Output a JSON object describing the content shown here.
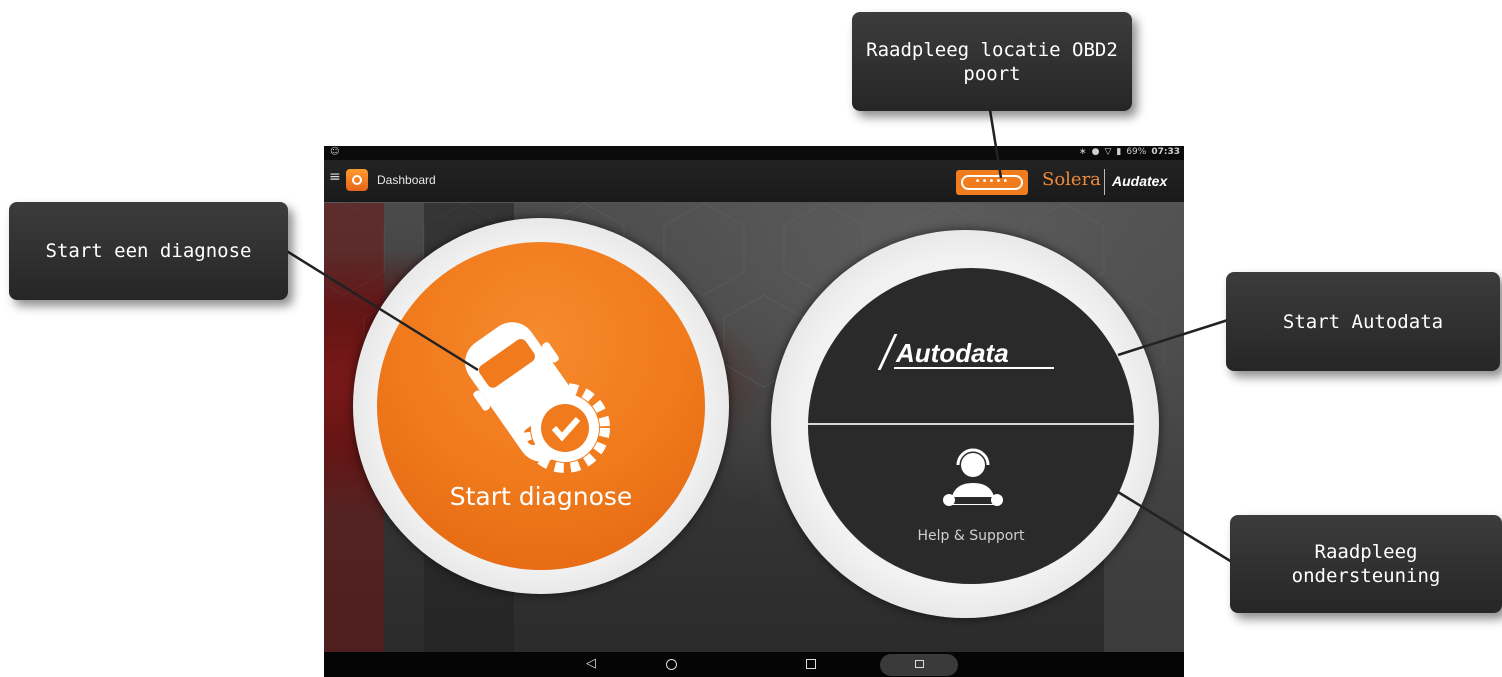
{
  "statusbar": {
    "left_icon": "android-debug-icon",
    "battery": "69%",
    "time": "07:33"
  },
  "appbar": {
    "title": "Dashboard",
    "obd_button_dots": "•••••",
    "brand_primary": "Solera",
    "brand_secondary": "Audatex"
  },
  "tiles": {
    "diagnose_label": "Start diagnose",
    "autodata_label": "Autodata",
    "help_label": "Help & Support"
  },
  "callouts": {
    "diagnose": "Start een diagnose",
    "obd": "Raadpleeg locatie OBD2 poort",
    "autodata": "Start Autodata",
    "support": "Raadpleeg ondersteuning"
  },
  "navbar": {
    "back_icon": "back-triangle-icon",
    "home_icon": "home-circle-icon",
    "recent_icon": "recent-square-icon"
  },
  "colors": {
    "accent": "#f07c1e",
    "dark_tile": "#2a2a2a",
    "callout_bg": "#2f2f2f"
  }
}
